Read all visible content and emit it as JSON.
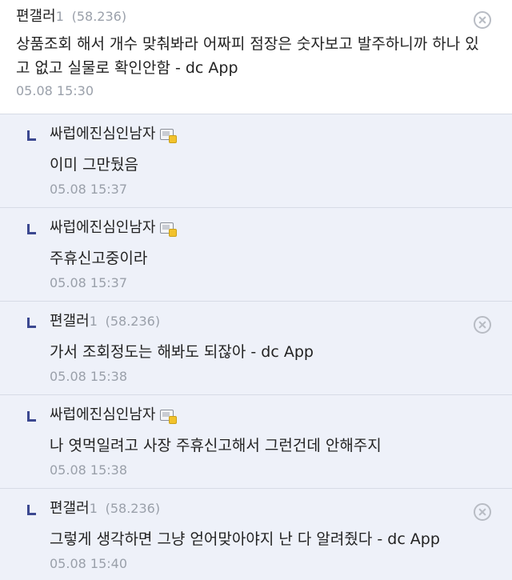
{
  "comments": [
    {
      "nick": "편갤러",
      "mark": "1",
      "ip": "(58.236)",
      "text": "상품조회 해서 개수 맞춰봐라 어짜피 점장은 숫자보고 발주하니까 하나 있고 없고 실물로 확인안함 - dc App",
      "date": "05.08 15:30"
    }
  ],
  "replies": [
    {
      "nick": "싸럽에진심인남자",
      "text": "이미 그만뒀음",
      "date": "05.08 15:37"
    },
    {
      "nick": "싸럽에진심인남자",
      "text": "주휴신고중이라",
      "date": "05.08 15:37"
    },
    {
      "nick": "편갤러",
      "mark": "1",
      "ip": "(58.236)",
      "text": "가서 조회정도는 해봐도 되잖아 - dc App",
      "date": "05.08 15:38"
    },
    {
      "nick": "싸럽에진심인남자",
      "text": "나 엿먹일려고 사장 주휴신고해서 그런건데 안해주지",
      "date": "05.08 15:38"
    },
    {
      "nick": "편갤러",
      "mark": "1",
      "ip": "(58.236)",
      "text": "그렇게 생각하면 그냥 얻어맞아야지 난 다 알려줬다 - dc App",
      "date": "05.08 15:40"
    }
  ]
}
